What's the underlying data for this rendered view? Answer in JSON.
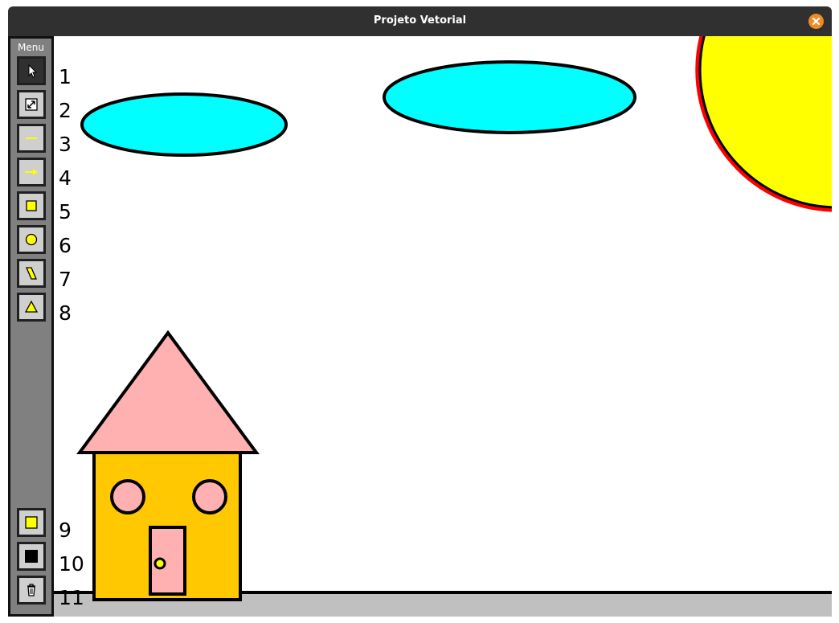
{
  "window": {
    "title": "Projeto Vetorial",
    "close_icon": "close-icon"
  },
  "toolbar": {
    "menu_label": "Menu",
    "tools": [
      {
        "number": "1",
        "icon": "cursor-icon",
        "selected": true
      },
      {
        "number": "2",
        "icon": "resize-icon"
      },
      {
        "number": "3",
        "icon": "line-icon"
      },
      {
        "number": "4",
        "icon": "arrow-icon"
      },
      {
        "number": "5",
        "icon": "rectangle-icon"
      },
      {
        "number": "6",
        "icon": "circle-icon"
      },
      {
        "number": "7",
        "icon": "parallelogram-icon"
      },
      {
        "number": "8",
        "icon": "triangle-icon"
      },
      {
        "number": "9",
        "icon": "fill-color-icon"
      },
      {
        "number": "10",
        "icon": "stroke-color-icon"
      },
      {
        "number": "11",
        "icon": "trash-icon"
      }
    ]
  },
  "colors": {
    "cloud_fill": "#00ffff",
    "sun_fill": "#ffff00",
    "sun_outline": "#ff0000",
    "roof_fill": "#ffb0b0",
    "wall_fill": "#ffc800",
    "ground_fill": "#c0c0c0",
    "tool_accent": "#ffff00"
  }
}
